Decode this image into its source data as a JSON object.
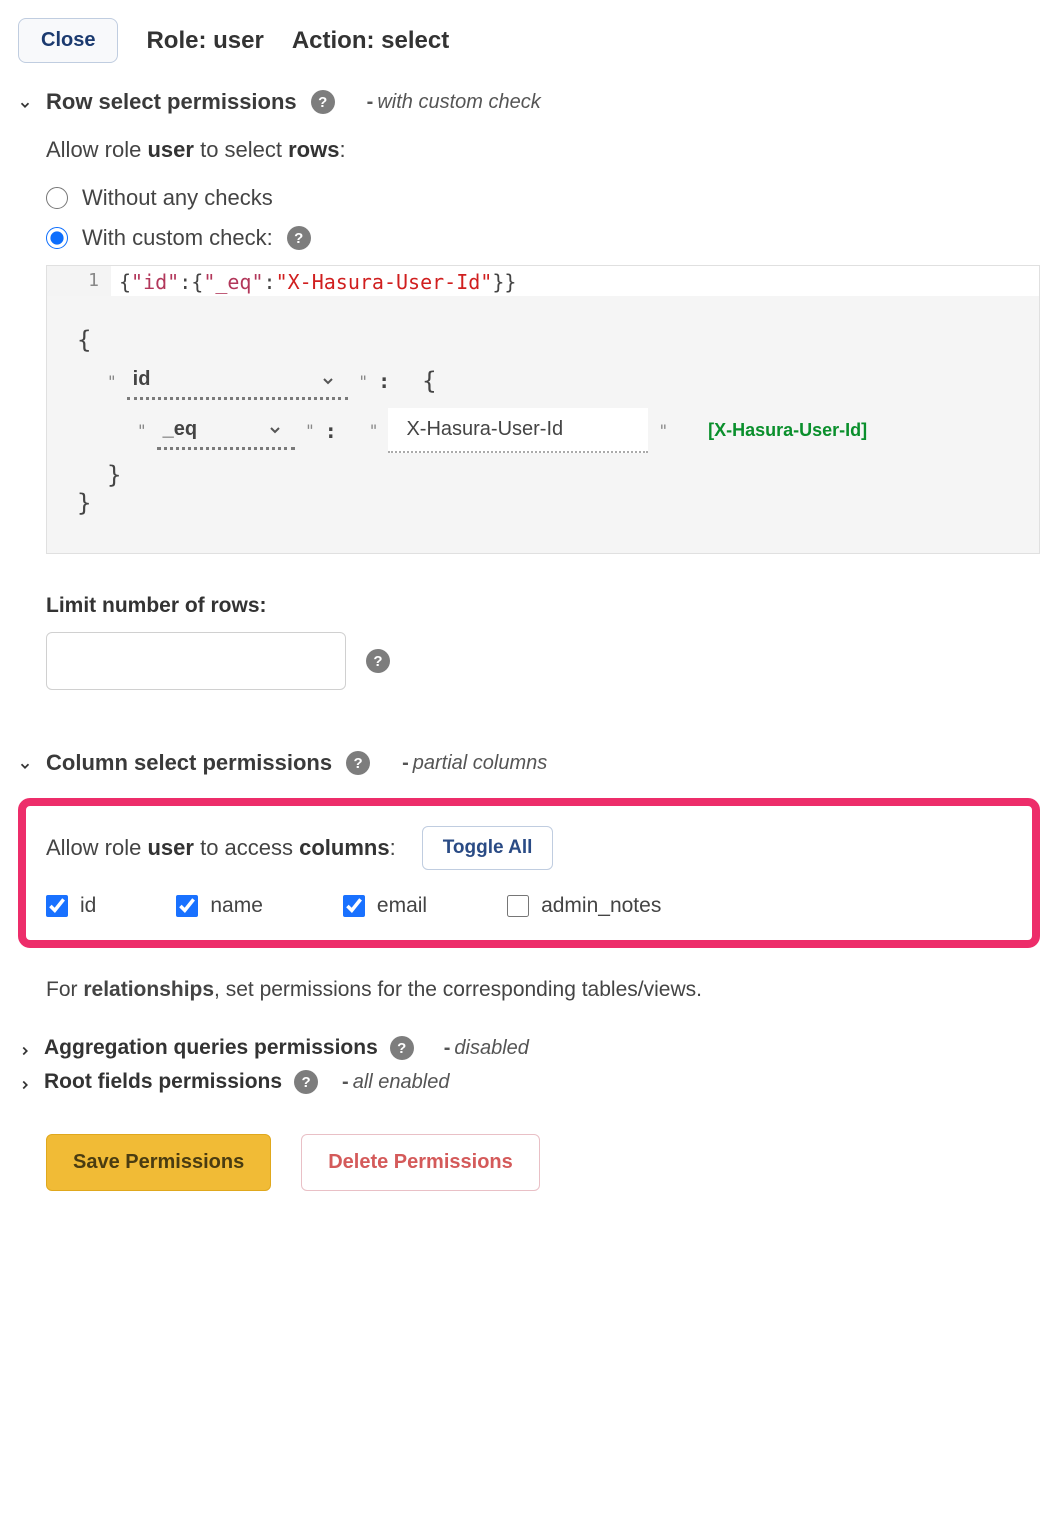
{
  "topbar": {
    "close_label": "Close",
    "role_label": "Role:",
    "role_value": "user",
    "action_label": "Action:",
    "action_value": "select"
  },
  "row_section": {
    "title": "Row select permissions",
    "hint": "with custom check",
    "allow_prefix": "Allow role ",
    "allow_role": "user",
    "allow_mid": " to select ",
    "allow_object": "rows",
    "radio_without": "Without any checks",
    "radio_custom": "With custom check:"
  },
  "code": {
    "line_no": "1",
    "raw_open": "{",
    "id_key": "\"id\"",
    "colon1": ":",
    "inner_open": "{",
    "eq_key": "\"_eq\"",
    "colon2": ":",
    "value": "\"X-Hasura-User-Id\"",
    "inner_close": "}",
    "raw_close": "}"
  },
  "builder": {
    "open": "{",
    "field1": "id",
    "op": "_eq",
    "value": "X-Hasura-User-Id",
    "session_var": "[X-Hasura-User-Id]",
    "close_inner": "}",
    "close_outer": "}"
  },
  "limit": {
    "label": "Limit number of rows:",
    "value": ""
  },
  "column_section": {
    "title": "Column select permissions",
    "hint": "partial columns",
    "allow_prefix": "Allow role ",
    "allow_role": "user",
    "allow_mid": " to access ",
    "allow_object": "columns",
    "toggle_label": "Toggle All",
    "columns": [
      {
        "name": "id",
        "checked": true
      },
      {
        "name": "name",
        "checked": true
      },
      {
        "name": "email",
        "checked": true
      },
      {
        "name": "admin_notes",
        "checked": false
      }
    ]
  },
  "relationships_note": {
    "prefix": "For ",
    "bold": "relationships",
    "suffix": ", set permissions for the corresponding tables/views."
  },
  "agg_section": {
    "title": "Aggregation queries permissions",
    "hint": "disabled"
  },
  "root_section": {
    "title": "Root fields permissions",
    "hint": "all enabled"
  },
  "footer": {
    "save": "Save Permissions",
    "delete": "Delete Permissions"
  }
}
